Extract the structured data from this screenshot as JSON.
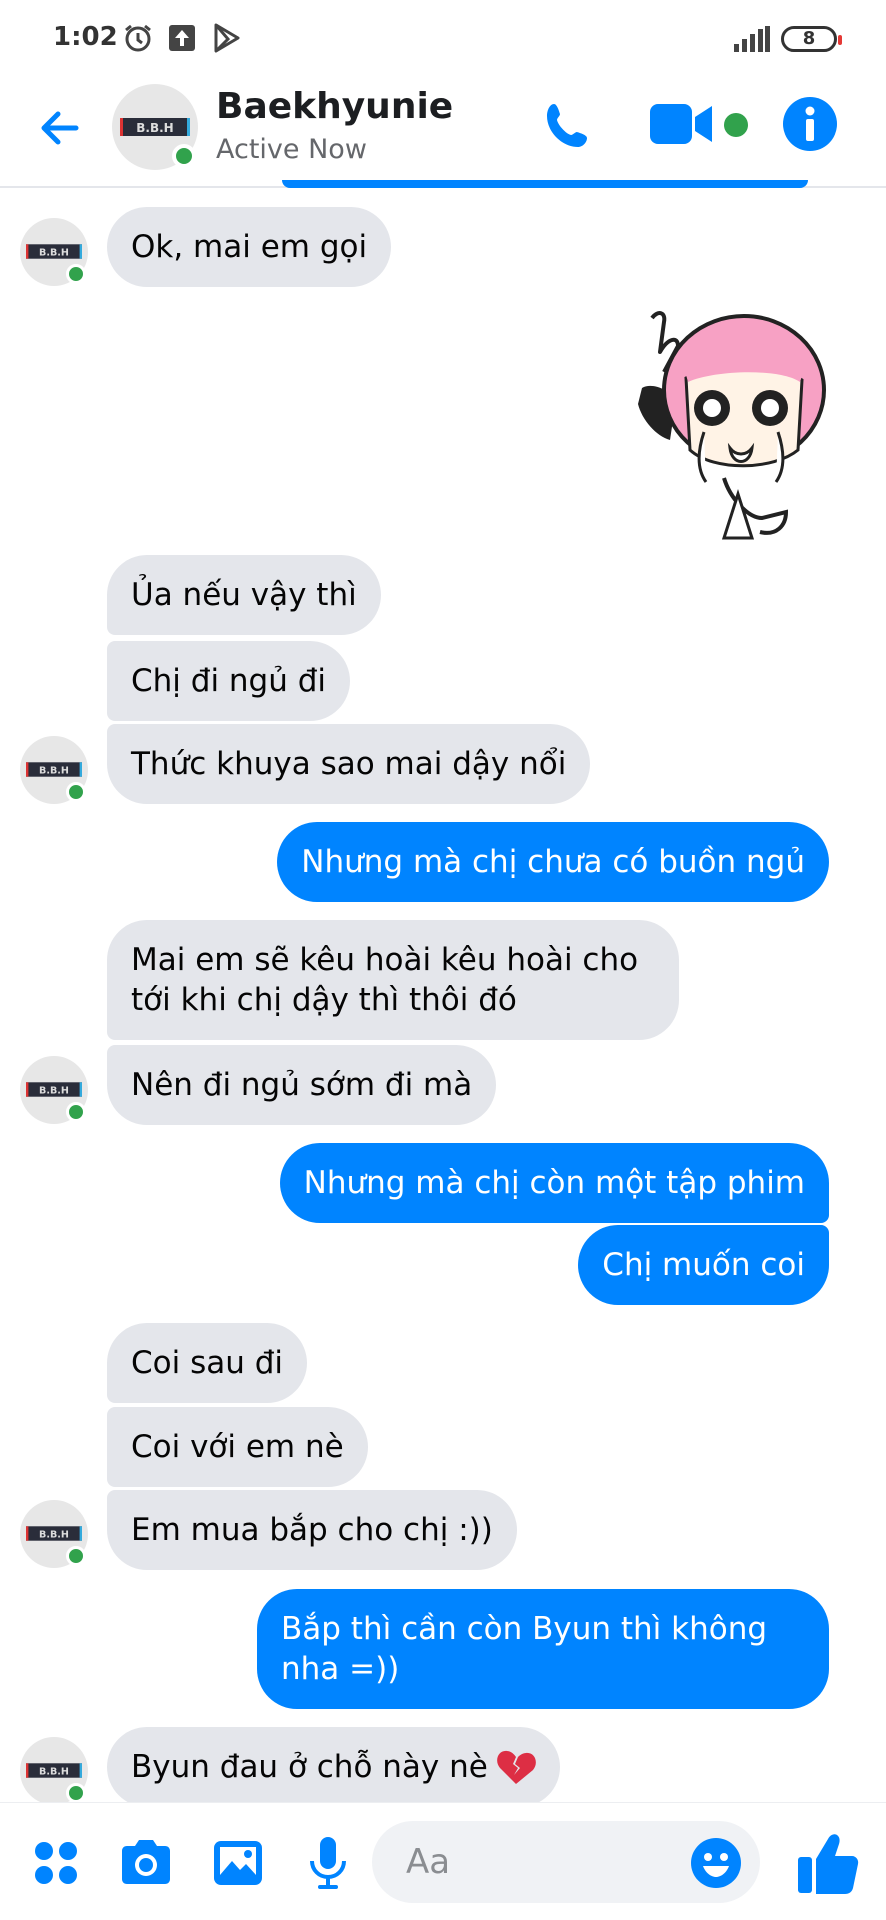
{
  "status_bar": {
    "time": "1:02",
    "battery": "8"
  },
  "header": {
    "contact_name": "Baekhyunie",
    "contact_status": "Active Now",
    "avatar_label": "B.B.H"
  },
  "messages": [
    {
      "text": "Ok, mai em gọi"
    },
    {
      "text": "Ủa nếu vậy thì"
    },
    {
      "text": "Chị đi ngủ đi"
    },
    {
      "text": "Thức khuya sao mai dậy nổi"
    },
    {
      "text": "Nhưng mà chị chưa có buồn ngủ"
    },
    {
      "line1": "Mai em sẽ kêu hoài kêu hoài cho",
      "line2": "tới khi chị dậy thì thôi đó"
    },
    {
      "text": "Nên đi ngủ sớm đi mà"
    },
    {
      "text": "Nhưng mà chị còn một tập phim"
    },
    {
      "text": "Chị muốn coi"
    },
    {
      "text": "Coi sau đi"
    },
    {
      "text": "Coi với em nè"
    },
    {
      "text": "Em mua bắp cho chị :))"
    },
    {
      "line1": "Bắp thì cần còn Byun thì không",
      "line2": "nha =))"
    },
    {
      "text": "Byun đau ở chỗ này nè"
    }
  ],
  "composer": {
    "placeholder": "Aa"
  },
  "colors": {
    "accent": "#0084ff",
    "incoming_bubble": "#e4e6eb",
    "online": "#31a24c"
  },
  "icons": [
    "back-arrow-icon",
    "phone-icon",
    "video-camera-icon",
    "info-icon",
    "apps-icon",
    "camera-icon",
    "image-icon",
    "microphone-icon",
    "emoji-icon",
    "thumbs-up-icon",
    "broken-heart-icon"
  ]
}
